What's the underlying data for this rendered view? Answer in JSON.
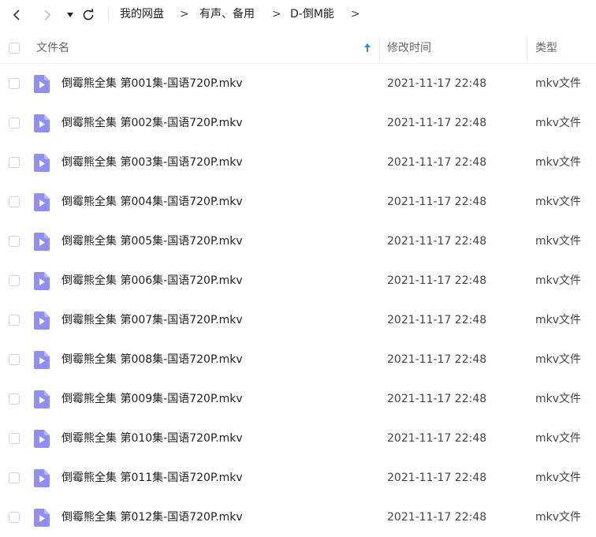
{
  "breadcrumb": {
    "items": [
      "我的网盘",
      "有声、备用",
      "D-倒M能"
    ],
    "separator": ">"
  },
  "header": {
    "name_label": "文件名",
    "modified_label": "修改时间",
    "type_label": "类型"
  },
  "colors": {
    "accent": "#1e90ff",
    "file_icon": "#8f8ff5"
  },
  "files": [
    {
      "name": "倒霉熊全集 第001集-国语720P.mkv",
      "modified": "2021-11-17 22:48",
      "type": "mkv文件"
    },
    {
      "name": "倒霉熊全集 第002集-国语720P.mkv",
      "modified": "2021-11-17 22:48",
      "type": "mkv文件"
    },
    {
      "name": "倒霉熊全集 第003集-国语720P.mkv",
      "modified": "2021-11-17 22:48",
      "type": "mkv文件"
    },
    {
      "name": "倒霉熊全集 第004集-国语720P.mkv",
      "modified": "2021-11-17 22:48",
      "type": "mkv文件"
    },
    {
      "name": "倒霉熊全集 第005集-国语720P.mkv",
      "modified": "2021-11-17 22:48",
      "type": "mkv文件"
    },
    {
      "name": "倒霉熊全集 第006集-国语720P.mkv",
      "modified": "2021-11-17 22:48",
      "type": "mkv文件"
    },
    {
      "name": "倒霉熊全集 第007集-国语720P.mkv",
      "modified": "2021-11-17 22:48",
      "type": "mkv文件"
    },
    {
      "name": "倒霉熊全集 第008集-国语720P.mkv",
      "modified": "2021-11-17 22:48",
      "type": "mkv文件"
    },
    {
      "name": "倒霉熊全集 第009集-国语720P.mkv",
      "modified": "2021-11-17 22:48",
      "type": "mkv文件"
    },
    {
      "name": "倒霉熊全集 第010集-国语720P.mkv",
      "modified": "2021-11-17 22:48",
      "type": "mkv文件"
    },
    {
      "name": "倒霉熊全集 第011集-国语720P.mkv",
      "modified": "2021-11-17 22:48",
      "type": "mkv文件"
    },
    {
      "name": "倒霉熊全集 第012集-国语720P.mkv",
      "modified": "2021-11-17 22:48",
      "type": "mkv文件"
    }
  ]
}
